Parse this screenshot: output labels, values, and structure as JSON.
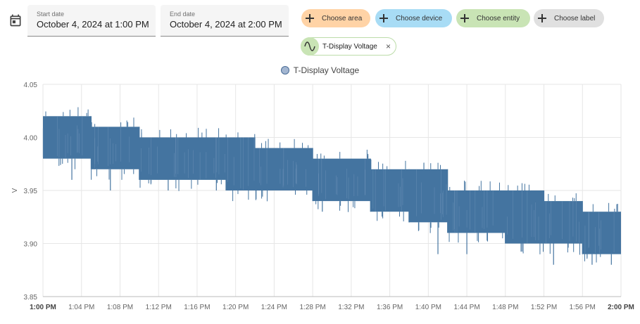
{
  "date_range": {
    "start": {
      "label": "Start date",
      "value": "October 4, 2024 at 1:00 PM"
    },
    "end": {
      "label": "End date",
      "value": "October 4, 2024 at 2:00 PM"
    }
  },
  "target_chips": [
    {
      "label": "Choose area",
      "color": "#ffd3a6"
    },
    {
      "label": "Choose device",
      "color": "#a8dcf5"
    },
    {
      "label": "Choose entity",
      "color": "#c9e4b5"
    },
    {
      "label": "Choose label",
      "color": "#e0e0e0"
    }
  ],
  "selected_entity": {
    "label": "T-Display Voltage",
    "icon": "sine-wave-icon"
  },
  "colors": {
    "series": "#4474a0",
    "legend_fill": "#a3b6d1",
    "grid": "#e6e6e6"
  },
  "chart_data": {
    "type": "line",
    "legend": [
      "T-Display Voltage"
    ],
    "ylabel": "V",
    "ylim": [
      3.85,
      4.05
    ],
    "y_ticks": [
      "4.05",
      "4.00",
      "3.95",
      "3.90",
      "3.85"
    ],
    "xlim": [
      "1:00 PM",
      "2:00 PM"
    ],
    "x_ticks": [
      "1:00 PM",
      "1:04 PM",
      "1:08 PM",
      "1:12 PM",
      "1:16 PM",
      "1:20 PM",
      "1:24 PM",
      "1:28 PM",
      "1:32 PM",
      "1:36 PM",
      "1:40 PM",
      "1:44 PM",
      "1:48 PM",
      "1:52 PM",
      "1:56 PM",
      "2:00 PM"
    ],
    "grid": true,
    "series": [
      {
        "name": "T-Display Voltage",
        "segments": [
          {
            "x": [
              "1:00 PM",
              "1:05 PM"
            ],
            "low": 3.98,
            "high": 4.02
          },
          {
            "x": [
              "1:05 PM",
              "1:10 PM"
            ],
            "low": 3.97,
            "high": 4.01
          },
          {
            "x": [
              "1:10 PM",
              "1:19 PM"
            ],
            "low": 3.96,
            "high": 4.0
          },
          {
            "x": [
              "1:19 PM",
              "1:22 PM"
            ],
            "low": 3.95,
            "high": 4.0
          },
          {
            "x": [
              "1:22 PM",
              "1:28 PM"
            ],
            "low": 3.95,
            "high": 3.99
          },
          {
            "x": [
              "1:28 PM",
              "1:34 PM"
            ],
            "low": 3.94,
            "high": 3.98
          },
          {
            "x": [
              "1:34 PM",
              "1:38 PM"
            ],
            "low": 3.93,
            "high": 3.97
          },
          {
            "x": [
              "1:38 PM",
              "1:42 PM"
            ],
            "low": 3.92,
            "high": 3.97
          },
          {
            "x": [
              "1:42 PM",
              "1:48 PM"
            ],
            "low": 3.91,
            "high": 3.95
          },
          {
            "x": [
              "1:48 PM",
              "1:52 PM"
            ],
            "low": 3.9,
            "high": 3.95
          },
          {
            "x": [
              "1:52 PM",
              "1:56 PM"
            ],
            "low": 3.9,
            "high": 3.94
          },
          {
            "x": [
              "1:56 PM",
              "2:00 PM"
            ],
            "low": 3.89,
            "high": 3.93
          }
        ],
        "min_spikes": [
          {
            "x": "1:03 PM",
            "y": 3.96
          },
          {
            "x": "1:07 PM",
            "y": 3.95
          },
          {
            "x": "1:13 PM",
            "y": 3.95
          },
          {
            "x": "1:18 PM",
            "y": 3.95
          },
          {
            "x": "1:29 PM",
            "y": 3.93
          },
          {
            "x": "1:38 PM",
            "y": 3.92
          },
          {
            "x": "1:41 PM",
            "y": 3.89
          },
          {
            "x": "1:44 PM",
            "y": 3.89
          },
          {
            "x": "1:48 PM",
            "y": 3.9
          },
          {
            "x": "1:53 PM",
            "y": 3.88
          },
          {
            "x": "1:57 PM",
            "y": 3.88
          },
          {
            "x": "1:59 PM",
            "y": 3.88
          }
        ]
      }
    ]
  }
}
